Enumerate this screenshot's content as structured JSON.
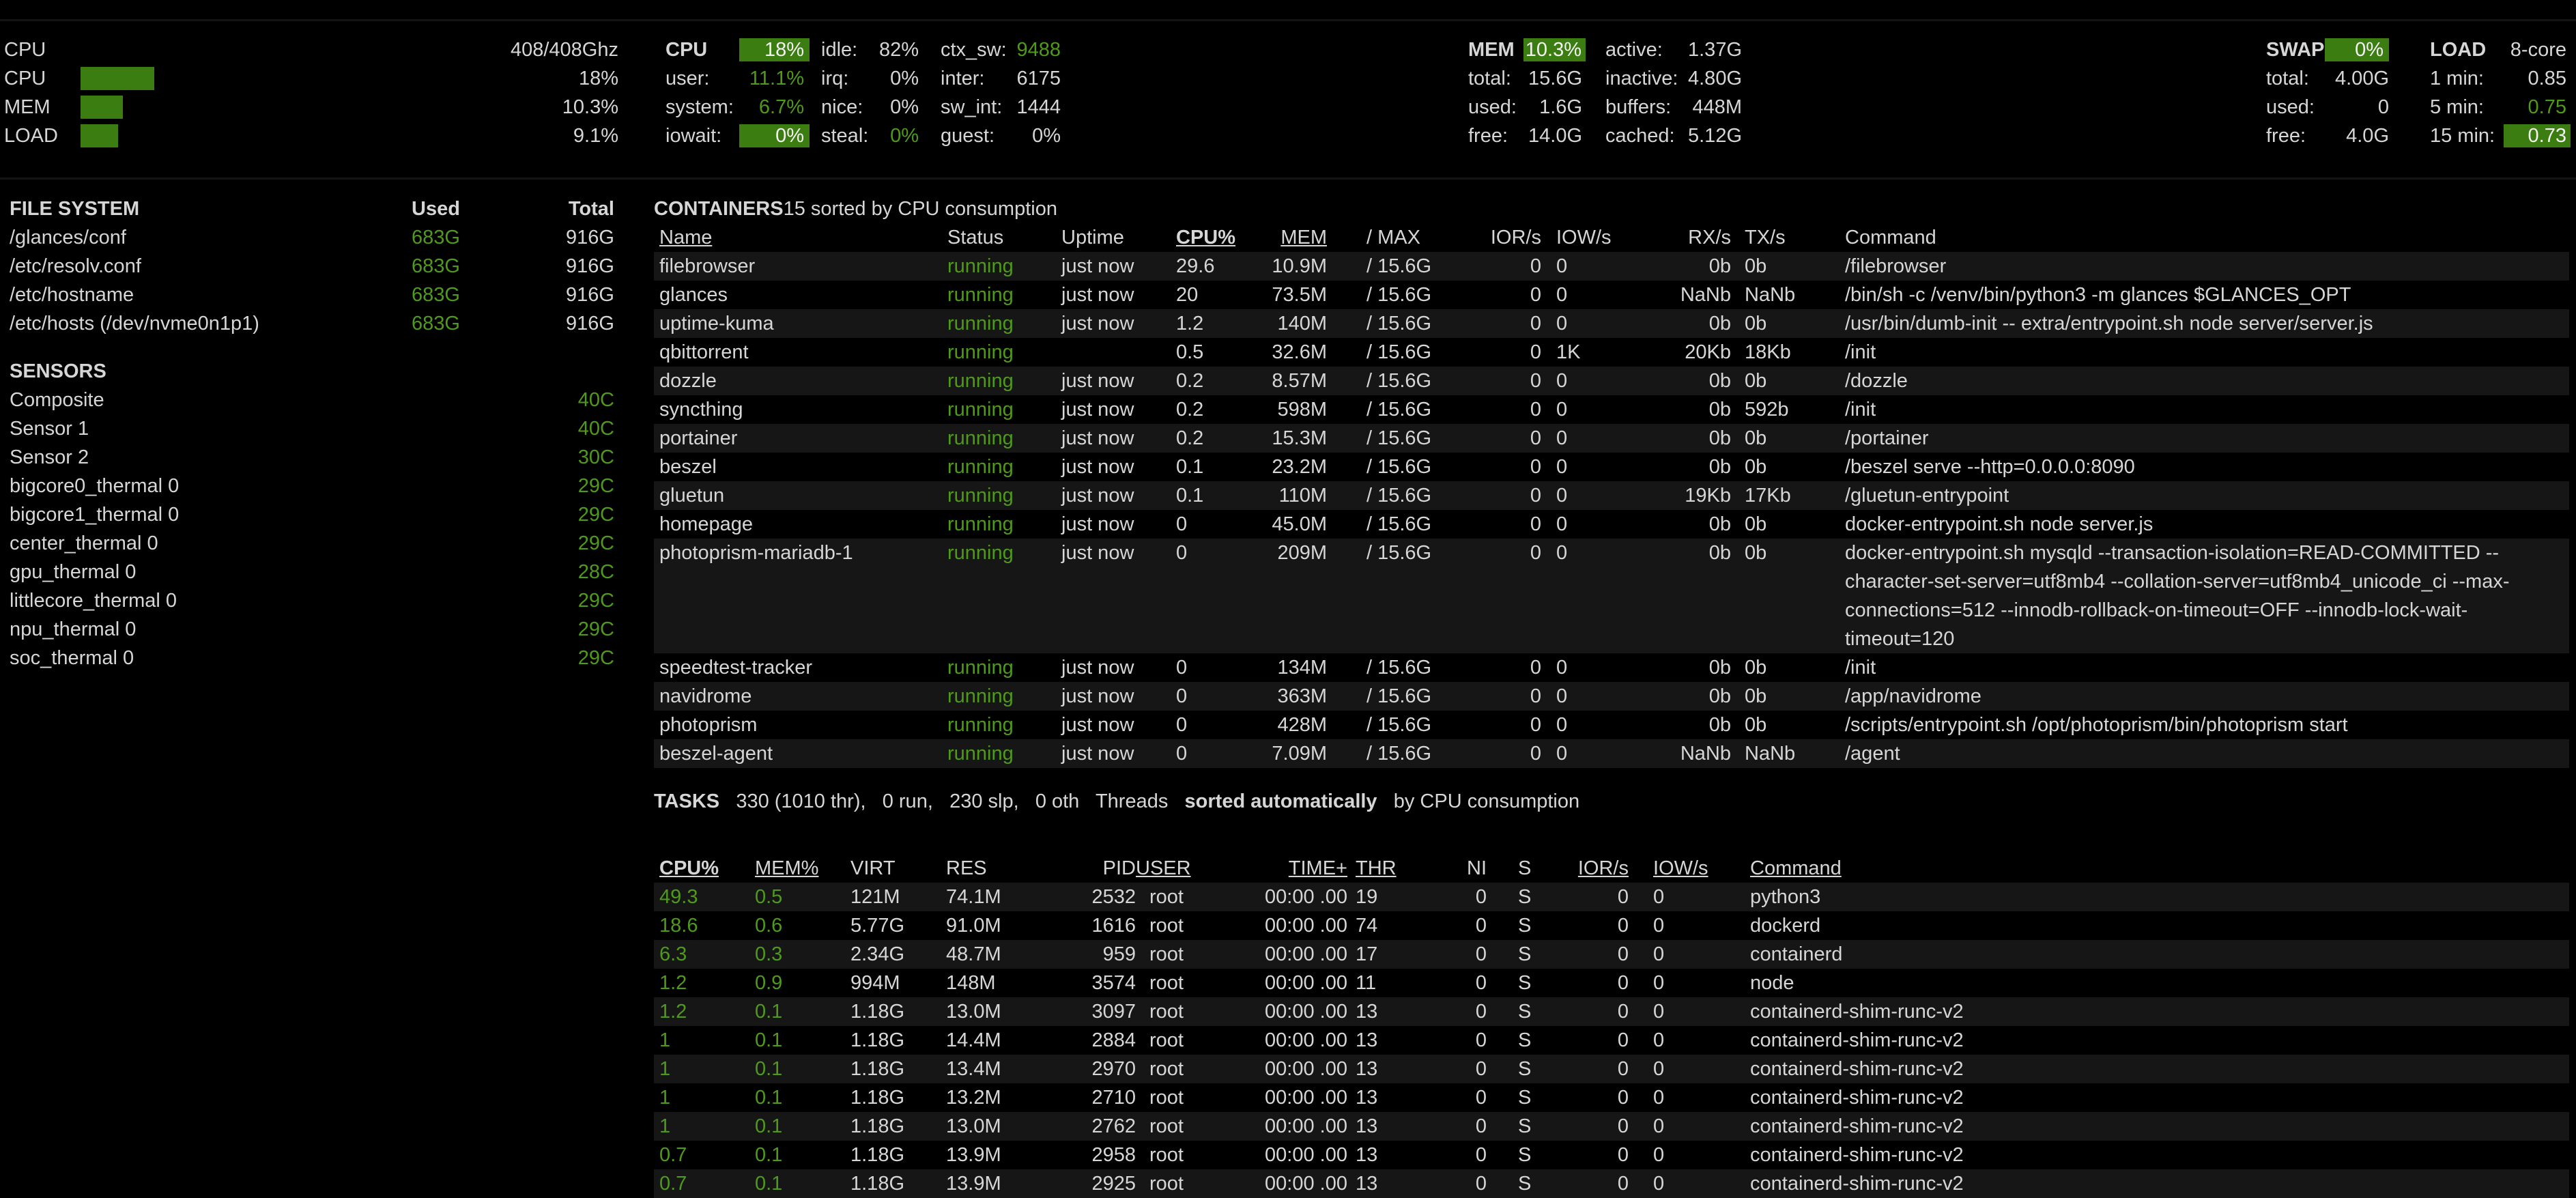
{
  "quicklook": {
    "cpu_label": "CPU",
    "cpu_freq": "408/408Ghz",
    "bars": [
      {
        "label": "CPU",
        "value": "18%",
        "fraction": 0.18
      },
      {
        "label": "MEM",
        "value": "10.3%",
        "fraction": 0.103
      },
      {
        "label": "LOAD",
        "value": "9.1%",
        "fraction": 0.091
      }
    ]
  },
  "cpu": {
    "title": "CPU",
    "total": "18%",
    "user_label": "user:",
    "user": "11.1%",
    "system_label": "system:",
    "system": "6.7%",
    "iowait_label": "iowait:",
    "iowait": "0%",
    "idle_label": "idle:",
    "idle": "82%",
    "irq_label": "irq:",
    "irq": "0%",
    "nice_label": "nice:",
    "nice": "0%",
    "steal_label": "steal:",
    "steal": "0%",
    "ctx_label": "ctx_sw:",
    "ctx": "9488",
    "inter_label": "inter:",
    "inter": "6175",
    "swint_label": "sw_int:",
    "swint": "1444",
    "guest_label": "guest:",
    "guest": "0%"
  },
  "mem": {
    "title": "MEM",
    "percent": "10.3%",
    "total_label": "total:",
    "total": "15.6G",
    "used_label": "used:",
    "used": "1.6G",
    "free_label": "free:",
    "free": "14.0G",
    "active_label": "active:",
    "active": "1.37G",
    "inactive_label": "inactive:",
    "inactive": "4.80G",
    "buffers_label": "buffers:",
    "buffers": "448M",
    "cached_label": "cached:",
    "cached": "5.12G"
  },
  "swap": {
    "title": "SWAP",
    "percent": "0%",
    "total_label": "total:",
    "total": "4.00G",
    "used_label": "used:",
    "used": "0",
    "free_label": "free:",
    "free": "4.0G"
  },
  "load": {
    "title": "LOAD",
    "cores": "8-core",
    "m1_label": "1 min:",
    "m1": "0.85",
    "m5_label": "5 min:",
    "m5": "0.75",
    "m15_label": "15 min:",
    "m15": "0.73"
  },
  "filesystem": {
    "title": "FILE SYSTEM",
    "used_header": "Used",
    "total_header": "Total",
    "rows": [
      {
        "mount": "/glances/conf",
        "used": "683G",
        "total": "916G"
      },
      {
        "mount": "/etc/resolv.conf",
        "used": "683G",
        "total": "916G"
      },
      {
        "mount": "/etc/hostname",
        "used": "683G",
        "total": "916G"
      },
      {
        "mount": "/etc/hosts (/dev/nvme0n1p1)",
        "used": "683G",
        "total": "916G"
      }
    ]
  },
  "sensors": {
    "title": "SENSORS",
    "rows": [
      {
        "name": "Composite",
        "value": "40C"
      },
      {
        "name": "Sensor 1",
        "value": "40C"
      },
      {
        "name": "Sensor 2",
        "value": "30C"
      },
      {
        "name": "bigcore0_thermal 0",
        "value": "29C"
      },
      {
        "name": "bigcore1_thermal 0",
        "value": "29C"
      },
      {
        "name": "center_thermal 0",
        "value": "29C"
      },
      {
        "name": "gpu_thermal 0",
        "value": "28C"
      },
      {
        "name": "littlecore_thermal 0",
        "value": "29C"
      },
      {
        "name": "npu_thermal 0",
        "value": "29C"
      },
      {
        "name": "soc_thermal 0",
        "value": "29C"
      }
    ]
  },
  "containers": {
    "title": "CONTAINERS",
    "count": "15",
    "sort_text": "sorted by CPU consumption",
    "headers": {
      "name": "Name",
      "status": "Status",
      "uptime": "Uptime",
      "cpu": "CPU%",
      "mem": "MEM",
      "max": "/ MAX",
      "ior": "IOR/s",
      "iow": "IOW/s",
      "rx": "RX/s",
      "tx": "TX/s",
      "command": "Command"
    },
    "rows": [
      {
        "name": "filebrowser",
        "status": "running",
        "uptime": "just now",
        "cpu": "29.6",
        "mem": "10.9M",
        "max": "/ 15.6G",
        "ior": "0",
        "iow": "0",
        "rx": "0b",
        "tx": "0b",
        "command": [
          "/filebrowser"
        ]
      },
      {
        "name": "glances",
        "status": "running",
        "uptime": "just now",
        "cpu": "20",
        "mem": "73.5M",
        "max": "/ 15.6G",
        "ior": "0",
        "iow": "0",
        "rx": "NaNb",
        "tx": "NaNb",
        "command": [
          "/bin/sh -c /venv/bin/python3 -m glances $GLANCES_OPT"
        ]
      },
      {
        "name": "uptime-kuma",
        "status": "running",
        "uptime": "just now",
        "cpu": "1.2",
        "mem": "140M",
        "max": "/ 15.6G",
        "ior": "0",
        "iow": "0",
        "rx": "0b",
        "tx": "0b",
        "command": [
          "/usr/bin/dumb-init -- extra/entrypoint.sh node server/server.js"
        ]
      },
      {
        "name": "qbittorrent",
        "status": "running",
        "uptime": "",
        "cpu": "0.5",
        "mem": "32.6M",
        "max": "/ 15.6G",
        "ior": "0",
        "iow": "1K",
        "rx": "20Kb",
        "tx": "18Kb",
        "command": [
          "/init"
        ]
      },
      {
        "name": "dozzle",
        "status": "running",
        "uptime": "just now",
        "cpu": "0.2",
        "mem": "8.57M",
        "max": "/ 15.6G",
        "ior": "0",
        "iow": "0",
        "rx": "0b",
        "tx": "0b",
        "command": [
          "/dozzle"
        ]
      },
      {
        "name": "syncthing",
        "status": "running",
        "uptime": "just now",
        "cpu": "0.2",
        "mem": "598M",
        "max": "/ 15.6G",
        "ior": "0",
        "iow": "0",
        "rx": "0b",
        "tx": "592b",
        "command": [
          "/init"
        ]
      },
      {
        "name": "portainer",
        "status": "running",
        "uptime": "just now",
        "cpu": "0.2",
        "mem": "15.3M",
        "max": "/ 15.6G",
        "ior": "0",
        "iow": "0",
        "rx": "0b",
        "tx": "0b",
        "command": [
          "/portainer"
        ]
      },
      {
        "name": "beszel",
        "status": "running",
        "uptime": "just now",
        "cpu": "0.1",
        "mem": "23.2M",
        "max": "/ 15.6G",
        "ior": "0",
        "iow": "0",
        "rx": "0b",
        "tx": "0b",
        "command": [
          "/beszel serve --http=0.0.0.0:8090"
        ]
      },
      {
        "name": "gluetun",
        "status": "running",
        "uptime": "just now",
        "cpu": "0.1",
        "mem": "110M",
        "max": "/ 15.6G",
        "ior": "0",
        "iow": "0",
        "rx": "19Kb",
        "tx": "17Kb",
        "command": [
          "/gluetun-entrypoint"
        ]
      },
      {
        "name": "homepage",
        "status": "running",
        "uptime": "just now",
        "cpu": "0",
        "mem": "45.0M",
        "max": "/ 15.6G",
        "ior": "0",
        "iow": "0",
        "rx": "0b",
        "tx": "0b",
        "command": [
          "docker-entrypoint.sh node server.js"
        ]
      },
      {
        "name": "photoprism-mariadb-1",
        "status": "running",
        "uptime": "just now",
        "cpu": "0",
        "mem": "209M",
        "max": "/ 15.6G",
        "ior": "0",
        "iow": "0",
        "rx": "0b",
        "tx": "0b",
        "command": [
          "docker-entrypoint.sh mysqld --transaction-isolation=READ-COMMITTED --",
          "character-set-server=utf8mb4 --collation-server=utf8mb4_unicode_ci --max-",
          "connections=512 --innodb-rollback-on-timeout=OFF --innodb-lock-wait-",
          "timeout=120"
        ]
      },
      {
        "name": "speedtest-tracker",
        "status": "running",
        "uptime": "just now",
        "cpu": "0",
        "mem": "134M",
        "max": "/ 15.6G",
        "ior": "0",
        "iow": "0",
        "rx": "0b",
        "tx": "0b",
        "command": [
          "/init"
        ]
      },
      {
        "name": "navidrome",
        "status": "running",
        "uptime": "just now",
        "cpu": "0",
        "mem": "363M",
        "max": "/ 15.6G",
        "ior": "0",
        "iow": "0",
        "rx": "0b",
        "tx": "0b",
        "command": [
          "/app/navidrome"
        ]
      },
      {
        "name": "photoprism",
        "status": "running",
        "uptime": "just now",
        "cpu": "0",
        "mem": "428M",
        "max": "/ 15.6G",
        "ior": "0",
        "iow": "0",
        "rx": "0b",
        "tx": "0b",
        "command": [
          "/scripts/entrypoint.sh /opt/photoprism/bin/photoprism start"
        ]
      },
      {
        "name": "beszel-agent",
        "status": "running",
        "uptime": "just now",
        "cpu": "0",
        "mem": "7.09M",
        "max": "/ 15.6G",
        "ior": "0",
        "iow": "0",
        "rx": "NaNb",
        "tx": "NaNb",
        "command": [
          "/agent"
        ]
      }
    ]
  },
  "tasks": {
    "title": "TASKS",
    "summary": "330 (1010 thr),",
    "run": "0 run,",
    "slp": "230 slp,",
    "oth": "0 oth",
    "threads": "Threads",
    "sorted": "sorted automatically",
    "by": "by CPU consumption"
  },
  "processes": {
    "headers": {
      "cpu": "CPU%",
      "mem": "MEM%",
      "virt": "VIRT",
      "res": "RES",
      "pid": "PID",
      "user": "USER",
      "time": "TIME+",
      "thr": "THR",
      "ni": "NI",
      "s": "S",
      "ior": "IOR/s",
      "iow": "IOW/s",
      "command": "Command"
    },
    "rows": [
      {
        "cpu": "49.3",
        "mem": "0.5",
        "virt": "121M",
        "res": "74.1M",
        "pid": "2532",
        "user": "root",
        "time": "00:00 .00",
        "thr": "19",
        "ni": "0",
        "s": "S",
        "ior": "0",
        "iow": "0",
        "command": "python3"
      },
      {
        "cpu": "18.6",
        "mem": "0.6",
        "virt": "5.77G",
        "res": "91.0M",
        "pid": "1616",
        "user": "root",
        "time": "00:00 .00",
        "thr": "74",
        "ni": "0",
        "s": "S",
        "ior": "0",
        "iow": "0",
        "command": "dockerd"
      },
      {
        "cpu": "6.3",
        "mem": "0.3",
        "virt": "2.34G",
        "res": "48.7M",
        "pid": "959",
        "user": "root",
        "time": "00:00 .00",
        "thr": "17",
        "ni": "0",
        "s": "S",
        "ior": "0",
        "iow": "0",
        "command": "containerd"
      },
      {
        "cpu": "1.2",
        "mem": "0.9",
        "virt": "994M",
        "res": "148M",
        "pid": "3574",
        "user": "root",
        "time": "00:00 .00",
        "thr": "11",
        "ni": "0",
        "s": "S",
        "ior": "0",
        "iow": "0",
        "command": "node"
      },
      {
        "cpu": "1.2",
        "mem": "0.1",
        "virt": "1.18G",
        "res": "13.0M",
        "pid": "3097",
        "user": "root",
        "time": "00:00 .00",
        "thr": "13",
        "ni": "0",
        "s": "S",
        "ior": "0",
        "iow": "0",
        "command": "containerd-shim-runc-v2"
      },
      {
        "cpu": "1",
        "mem": "0.1",
        "virt": "1.18G",
        "res": "14.4M",
        "pid": "2884",
        "user": "root",
        "time": "00:00 .00",
        "thr": "13",
        "ni": "0",
        "s": "S",
        "ior": "0",
        "iow": "0",
        "command": "containerd-shim-runc-v2"
      },
      {
        "cpu": "1",
        "mem": "0.1",
        "virt": "1.18G",
        "res": "13.4M",
        "pid": "2970",
        "user": "root",
        "time": "00:00 .00",
        "thr": "13",
        "ni": "0",
        "s": "S",
        "ior": "0",
        "iow": "0",
        "command": "containerd-shim-runc-v2"
      },
      {
        "cpu": "1",
        "mem": "0.1",
        "virt": "1.18G",
        "res": "13.2M",
        "pid": "2710",
        "user": "root",
        "time": "00:00 .00",
        "thr": "13",
        "ni": "0",
        "s": "S",
        "ior": "0",
        "iow": "0",
        "command": "containerd-shim-runc-v2"
      },
      {
        "cpu": "1",
        "mem": "0.1",
        "virt": "1.18G",
        "res": "13.0M",
        "pid": "2762",
        "user": "root",
        "time": "00:00 .00",
        "thr": "13",
        "ni": "0",
        "s": "S",
        "ior": "0",
        "iow": "0",
        "command": "containerd-shim-runc-v2"
      },
      {
        "cpu": "0.7",
        "mem": "0.1",
        "virt": "1.18G",
        "res": "13.9M",
        "pid": "2958",
        "user": "root",
        "time": "00:00 .00",
        "thr": "13",
        "ni": "0",
        "s": "S",
        "ior": "0",
        "iow": "0",
        "command": "containerd-shim-runc-v2"
      },
      {
        "cpu": "0.7",
        "mem": "0.1",
        "virt": "1.18G",
        "res": "13.9M",
        "pid": "2925",
        "user": "root",
        "time": "00:00 .00",
        "thr": "13",
        "ni": "0",
        "s": "S",
        "ior": "0",
        "iow": "0",
        "command": "containerd-shim-runc-v2"
      }
    ]
  }
}
